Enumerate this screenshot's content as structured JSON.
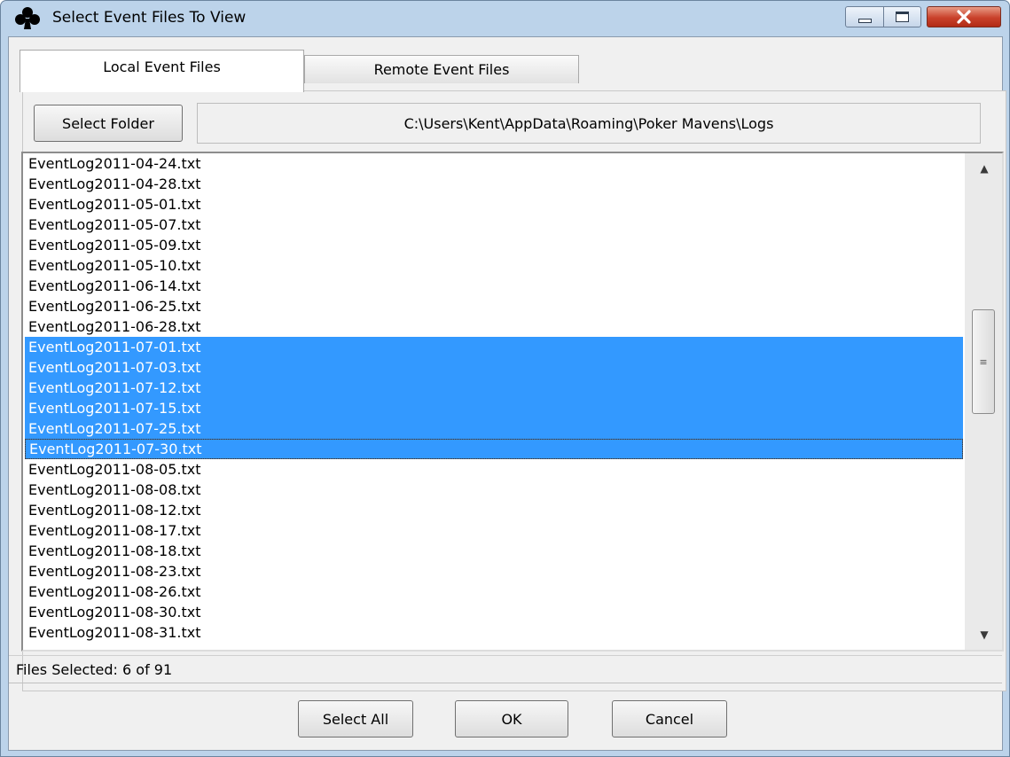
{
  "window": {
    "title": "Select Event Files To View",
    "icon": "club-icon"
  },
  "tabs": [
    {
      "label": "Local Event Files",
      "active": true
    },
    {
      "label": "Remote Event Files",
      "active": false
    }
  ],
  "folder": {
    "button_label": "Select Folder",
    "path": "C:\\Users\\Kent\\AppData\\Roaming\\Poker Mavens\\Logs"
  },
  "files": [
    {
      "name": "EventLog2011-04-24.txt",
      "selected": false
    },
    {
      "name": "EventLog2011-04-28.txt",
      "selected": false
    },
    {
      "name": "EventLog2011-05-01.txt",
      "selected": false
    },
    {
      "name": "EventLog2011-05-07.txt",
      "selected": false
    },
    {
      "name": "EventLog2011-05-09.txt",
      "selected": false
    },
    {
      "name": "EventLog2011-05-10.txt",
      "selected": false
    },
    {
      "name": "EventLog2011-06-14.txt",
      "selected": false
    },
    {
      "name": "EventLog2011-06-25.txt",
      "selected": false
    },
    {
      "name": "EventLog2011-06-28.txt",
      "selected": false
    },
    {
      "name": "EventLog2011-07-01.txt",
      "selected": true
    },
    {
      "name": "EventLog2011-07-03.txt",
      "selected": true
    },
    {
      "name": "EventLog2011-07-12.txt",
      "selected": true
    },
    {
      "name": "EventLog2011-07-15.txt",
      "selected": true
    },
    {
      "name": "EventLog2011-07-25.txt",
      "selected": true
    },
    {
      "name": "EventLog2011-07-30.txt",
      "selected": true,
      "focused": true
    },
    {
      "name": "EventLog2011-08-05.txt",
      "selected": false
    },
    {
      "name": "EventLog2011-08-08.txt",
      "selected": false
    },
    {
      "name": "EventLog2011-08-12.txt",
      "selected": false
    },
    {
      "name": "EventLog2011-08-17.txt",
      "selected": false
    },
    {
      "name": "EventLog2011-08-18.txt",
      "selected": false
    },
    {
      "name": "EventLog2011-08-23.txt",
      "selected": false
    },
    {
      "name": "EventLog2011-08-26.txt",
      "selected": false
    },
    {
      "name": "EventLog2011-08-30.txt",
      "selected": false
    },
    {
      "name": "EventLog2011-08-31.txt",
      "selected": false
    }
  ],
  "status": {
    "text": "Files Selected: 6 of 91"
  },
  "buttons": {
    "select_all": "Select All",
    "ok": "OK",
    "cancel": "Cancel"
  },
  "colors": {
    "selection": "#3399ff",
    "selection_text": "#ffffff",
    "close_button": "#c9412b"
  }
}
